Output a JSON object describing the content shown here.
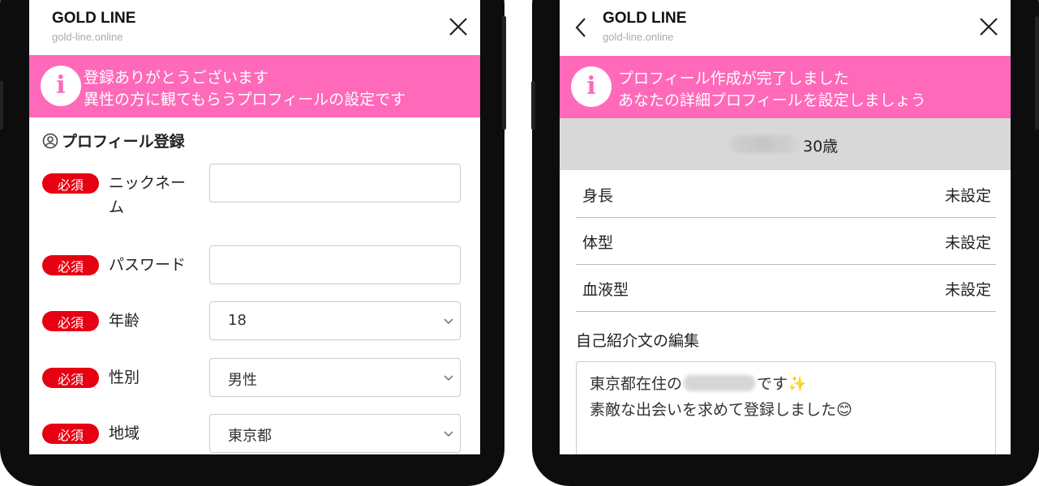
{
  "left_screen": {
    "app_title": "GOLD LINE",
    "app_url": "gold-line.online",
    "banner": {
      "icon": "info-icon",
      "line1": "登録ありがとうございます",
      "line2": "異性の方に観てもらうプロフィールの設定です"
    },
    "section_title": "プロフィール登録",
    "required_label": "必須",
    "fields": [
      {
        "label": "ニックネーム",
        "value": ""
      },
      {
        "label": "パスワード",
        "value": ""
      },
      {
        "label": "年齢",
        "value": "18"
      },
      {
        "label": "性別",
        "value": "男性"
      },
      {
        "label": "地域",
        "value": "東京都"
      }
    ]
  },
  "right_screen": {
    "app_title": "GOLD LINE",
    "app_url": "gold-line.online",
    "banner": {
      "icon": "info-icon",
      "line1": "プロフィール作成が完了しました",
      "line2": "あなたの詳細プロフィールを設定しましょう"
    },
    "age": "30歳",
    "details": [
      {
        "label": "身長",
        "value": "未設定"
      },
      {
        "label": "体型",
        "value": "未設定"
      },
      {
        "label": "血液型",
        "value": "未設定"
      }
    ],
    "intro_title": "自己紹介文の編集",
    "intro_text": {
      "line1_before": "東京都在住の",
      "line1_after": "です✨",
      "line2": "素敵な出会いを求めて登録しました😊"
    }
  },
  "colors": {
    "banner": "#ff69b9",
    "required_badge": "#e60012",
    "gray_bar": "#d8d8d8"
  }
}
